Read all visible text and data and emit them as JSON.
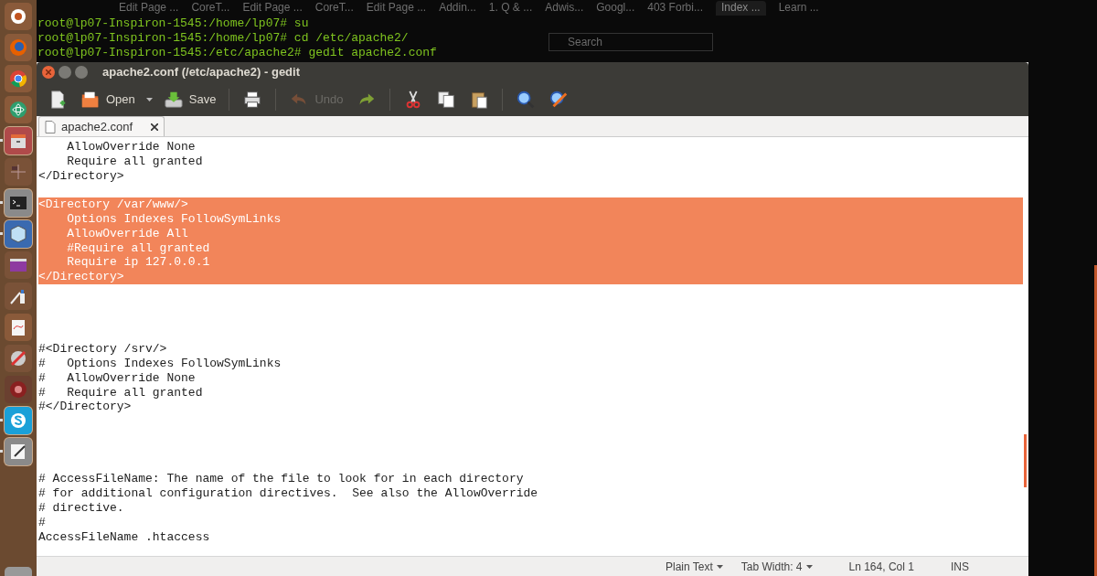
{
  "browser_tabs": [
    {
      "label": "Edit Page ..."
    },
    {
      "label": "CoreT..."
    },
    {
      "label": "Edit Page ..."
    },
    {
      "label": "CoreT..."
    },
    {
      "label": "Edit Page ..."
    },
    {
      "label": "Addin..."
    },
    {
      "label": "1. Q & ..."
    },
    {
      "label": "Adwis..."
    },
    {
      "label": "Googl..."
    },
    {
      "label": "403 Forbi..."
    },
    {
      "label": "Index ...",
      "selected": true
    },
    {
      "label": "Learn ..."
    }
  ],
  "browser_search": {
    "placeholder": "Search"
  },
  "terminal_lines": [
    "root@lp07-Inspiron-1545:/home/lp07# su",
    "root@lp07-Inspiron-1545:/home/lp07# cd /etc/apache2/",
    "root@lp07-Inspiron-1545:/etc/apache2# gedit apache2.conf"
  ],
  "launcher": [
    {
      "kind": "dash",
      "running": false
    },
    {
      "kind": "firefox",
      "running": false
    },
    {
      "kind": "chrome",
      "running": false
    },
    {
      "kind": "atom",
      "running": false
    },
    {
      "kind": "files",
      "running": true
    },
    {
      "kind": "workspaces",
      "running": false
    },
    {
      "kind": "terminal",
      "running": true
    },
    {
      "kind": "cube",
      "running": true
    },
    {
      "kind": "window",
      "running": false
    },
    {
      "kind": "paint",
      "running": false
    },
    {
      "kind": "document",
      "running": false
    },
    {
      "kind": "tools",
      "running": false
    },
    {
      "kind": "disc",
      "running": false
    },
    {
      "kind": "skype",
      "running": true
    },
    {
      "kind": "editor",
      "running": true
    }
  ],
  "window": {
    "title": "apache2.conf (/etc/apache2) - gedit"
  },
  "toolbar": [
    {
      "kind": "new",
      "disabled": false
    },
    {
      "kind": "open",
      "label": "Open",
      "disabled": false
    },
    {
      "kind": "save",
      "label": "Save",
      "disabled": false
    },
    {
      "kind": "sep"
    },
    {
      "kind": "print",
      "disabled": false
    },
    {
      "kind": "sep"
    },
    {
      "kind": "undo",
      "label": "Undo",
      "disabled": true
    },
    {
      "kind": "redo",
      "disabled": false
    },
    {
      "kind": "sep"
    },
    {
      "kind": "cut",
      "disabled": false
    },
    {
      "kind": "copy",
      "disabled": false
    },
    {
      "kind": "paste",
      "disabled": false
    },
    {
      "kind": "sep"
    },
    {
      "kind": "find",
      "disabled": false
    },
    {
      "kind": "replace",
      "disabled": false
    }
  ],
  "document_tab": {
    "label": "apache2.conf",
    "selected": true
  },
  "editor_lines": [
    {
      "kind": "text",
      "text": "    AllowOverride None",
      "selected": false
    },
    {
      "kind": "text",
      "text": "    Require all granted",
      "selected": false
    },
    {
      "kind": "text",
      "text": "</Directory>",
      "selected": false
    },
    {
      "kind": "blank"
    },
    {
      "kind": "text",
      "text": "<Directory /var/www/>",
      "selected": true
    },
    {
      "kind": "text",
      "text": "    Options Indexes FollowSymLinks",
      "selected": true
    },
    {
      "kind": "text",
      "text": "    AllowOverride All",
      "selected": true
    },
    {
      "kind": "text",
      "text": "    #Require all granted",
      "selected": true
    },
    {
      "kind": "text",
      "text": "    Require ip 127.0.0.1",
      "selected": true
    },
    {
      "kind": "text",
      "text": "</Directory>",
      "selected": true
    },
    {
      "kind": "blank"
    },
    {
      "kind": "blank"
    },
    {
      "kind": "blank"
    },
    {
      "kind": "blank"
    },
    {
      "kind": "text",
      "text": "#<Directory /srv/>",
      "selected": false
    },
    {
      "kind": "text",
      "text": "#   Options Indexes FollowSymLinks",
      "selected": false
    },
    {
      "kind": "text",
      "text": "#   AllowOverride None",
      "selected": false
    },
    {
      "kind": "text",
      "text": "#   Require all granted",
      "selected": false
    },
    {
      "kind": "text",
      "text": "#</Directory>",
      "selected": false
    },
    {
      "kind": "blank"
    },
    {
      "kind": "blank"
    },
    {
      "kind": "blank"
    },
    {
      "kind": "blank"
    },
    {
      "kind": "text",
      "text": "# AccessFileName: The name of the file to look for in each directory",
      "selected": false
    },
    {
      "kind": "text",
      "text": "# for additional configuration directives.  See also the AllowOverride",
      "selected": false
    },
    {
      "kind": "text",
      "text": "# directive.",
      "selected": false
    },
    {
      "kind": "text",
      "text": "#",
      "selected": false
    },
    {
      "kind": "text",
      "text": "AccessFileName .htaccess",
      "selected": false
    }
  ],
  "status_bar": {
    "language": "Plain Text",
    "tab_width": "Tab Width: 4",
    "position": "Ln 164, Col 1",
    "mode": "INS"
  }
}
